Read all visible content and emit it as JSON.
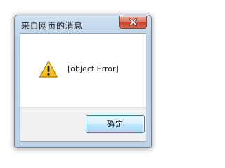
{
  "dialog": {
    "title": "来自网页的消息",
    "close_icon": "close-icon",
    "message": "[object Error]",
    "message_icon": "warning-icon",
    "ok_label": "确定"
  },
  "colors": {
    "titlebar": "#bcd2e7",
    "close_button": "#c9462e",
    "ok_button": "#bee6fd",
    "warning_yellow": "#f4c20d"
  }
}
